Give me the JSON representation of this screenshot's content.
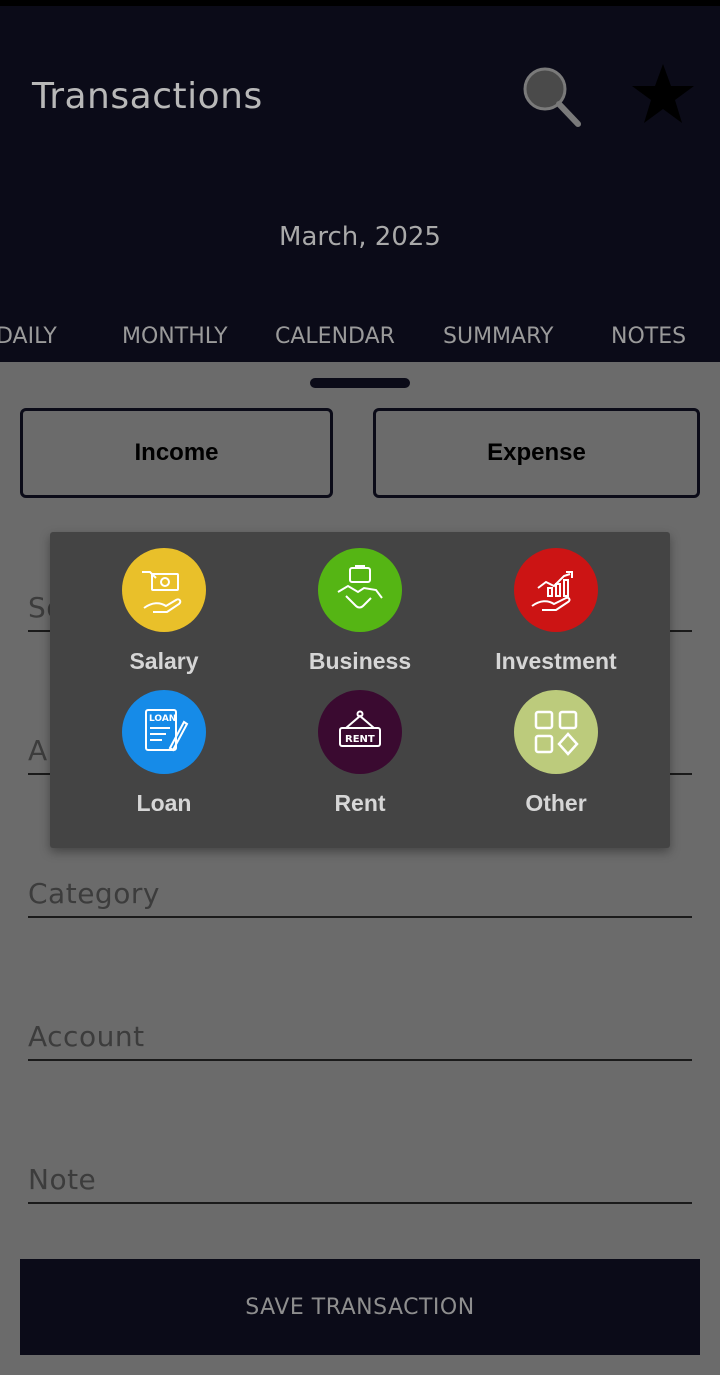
{
  "header": {
    "title": "Transactions",
    "month": "March, 2025",
    "search_icon": "search-icon",
    "star_icon": "star-icon"
  },
  "tabs": [
    "DAILY",
    "MONTHLY",
    "CALENDAR",
    "SUMMARY",
    "NOTES"
  ],
  "form": {
    "income_label": "Income",
    "expense_label": "Expense",
    "fields": {
      "source_partial": "So",
      "amount_partial": "Am",
      "category": "Category",
      "account": "Account",
      "note": "Note"
    },
    "save_label": "SAVE TRANSACTION"
  },
  "category_picker": {
    "items": [
      {
        "label": "Salary",
        "color": "#e9c02a",
        "icon": "salary-icon"
      },
      {
        "label": "Business",
        "color": "#55b514",
        "icon": "handshake-icon"
      },
      {
        "label": "Investment",
        "color": "#cc1414",
        "icon": "investment-icon"
      },
      {
        "label": "Loan",
        "color": "#168be8",
        "icon": "loan-icon"
      },
      {
        "label": "Rent",
        "color": "#3a0a30",
        "icon": "rent-sign-icon"
      },
      {
        "label": "Other",
        "color": "#bccb7c",
        "icon": "other-grid-icon"
      }
    ]
  },
  "colors": {
    "header_bg": "#0b0b18",
    "sheet_bg": "#6b6b6b",
    "popup_bg": "#444444"
  }
}
